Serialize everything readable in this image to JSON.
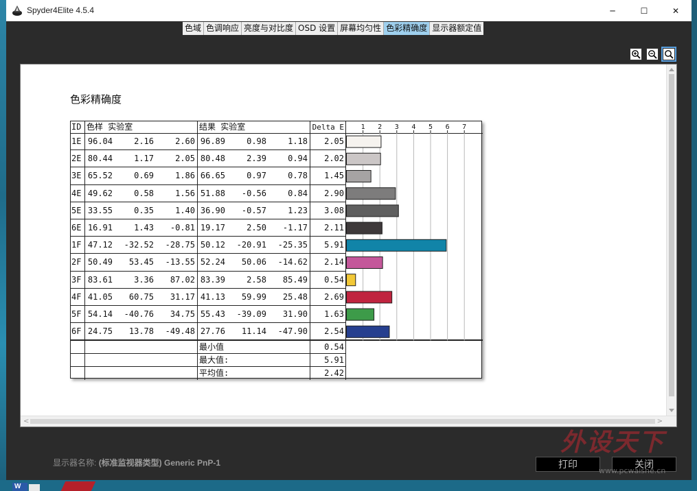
{
  "window": {
    "title": "Spyder4Elite 4.5.4",
    "controls": {
      "minimize": "─",
      "maximize": "☐",
      "close": "✕"
    }
  },
  "tabs": [
    {
      "label": "色域",
      "active": false
    },
    {
      "label": "色调响应",
      "active": false
    },
    {
      "label": "亮度与对比度",
      "active": false
    },
    {
      "label": "OSD 设置",
      "active": false
    },
    {
      "label": "屏幕均匀性",
      "active": false
    },
    {
      "label": "色彩精确度",
      "active": true
    },
    {
      "label": "显示器额定值",
      "active": false
    }
  ],
  "zoom_tools": [
    "zoom-in-icon",
    "zoom-out-icon",
    "zoom-fit-icon"
  ],
  "report": {
    "title": "色彩精确度",
    "headers": {
      "id": "ID",
      "sample": "色样 实验室",
      "result": "结果 实验室",
      "delta": "Delta E"
    },
    "rows": [
      {
        "id": "1E",
        "sample": [
          "96.04",
          "2.16",
          "2.60"
        ],
        "result": [
          "96.89",
          "0.98",
          "1.18"
        ],
        "delta": "2.05"
      },
      {
        "id": "2E",
        "sample": [
          "80.44",
          "1.17",
          "2.05"
        ],
        "result": [
          "80.48",
          "2.39",
          "0.94"
        ],
        "delta": "2.02"
      },
      {
        "id": "3E",
        "sample": [
          "65.52",
          "0.69",
          "1.86"
        ],
        "result": [
          "66.65",
          "0.97",
          "0.78"
        ],
        "delta": "1.45"
      },
      {
        "id": "4E",
        "sample": [
          "49.62",
          "0.58",
          "1.56"
        ],
        "result": [
          "51.88",
          "-0.56",
          "0.84"
        ],
        "delta": "2.90"
      },
      {
        "id": "5E",
        "sample": [
          "33.55",
          "0.35",
          "1.40"
        ],
        "result": [
          "36.90",
          "-0.57",
          "1.23"
        ],
        "delta": "3.08"
      },
      {
        "id": "6E",
        "sample": [
          "16.91",
          "1.43",
          "-0.81"
        ],
        "result": [
          "19.17",
          "2.50",
          "-1.17"
        ],
        "delta": "2.11"
      },
      {
        "id": "1F",
        "sample": [
          "47.12",
          "-32.52",
          "-28.75"
        ],
        "result": [
          "50.12",
          "-20.91",
          "-25.35"
        ],
        "delta": "5.91"
      },
      {
        "id": "2F",
        "sample": [
          "50.49",
          "53.45",
          "-13.55"
        ],
        "result": [
          "52.24",
          "50.06",
          "-14.62"
        ],
        "delta": "2.14"
      },
      {
        "id": "3F",
        "sample": [
          "83.61",
          "3.36",
          "87.02"
        ],
        "result": [
          "83.39",
          "2.58",
          "85.49"
        ],
        "delta": "0.54"
      },
      {
        "id": "4F",
        "sample": [
          "41.05",
          "60.75",
          "31.17"
        ],
        "result": [
          "41.13",
          "59.99",
          "25.48"
        ],
        "delta": "2.69"
      },
      {
        "id": "5F",
        "sample": [
          "54.14",
          "-40.76",
          "34.75"
        ],
        "result": [
          "55.43",
          "-39.09",
          "31.90"
        ],
        "delta": "1.63"
      },
      {
        "id": "6F",
        "sample": [
          "24.75",
          "13.78",
          "-49.48"
        ],
        "result": [
          "27.76",
          "11.14",
          "-47.90"
        ],
        "delta": "2.54"
      }
    ],
    "summary": [
      {
        "label": "最小值",
        "value": "0.54"
      },
      {
        "label": "最大值:",
        "value": "5.91"
      },
      {
        "label": "平均值:",
        "value": "2.42"
      }
    ]
  },
  "chart_data": {
    "type": "bar",
    "orientation": "horizontal",
    "categories": [
      "1E",
      "2E",
      "3E",
      "4E",
      "5E",
      "6E",
      "1F",
      "2F",
      "3F",
      "4F",
      "5F",
      "6F"
    ],
    "values": [
      2.05,
      2.02,
      1.45,
      2.9,
      3.08,
      2.11,
      5.91,
      2.14,
      0.54,
      2.69,
      1.63,
      2.54
    ],
    "colors": [
      "#f6f3ef",
      "#cbc6c6",
      "#a6a3a3",
      "#7d7c7c",
      "#5f5f5f",
      "#3e393a",
      "#1184a8",
      "#c4579a",
      "#f2c837",
      "#c0243f",
      "#3d9b49",
      "#263f8f"
    ],
    "xticks": [
      "1",
      "2",
      "3",
      "4",
      "5",
      "6",
      "7"
    ],
    "xlim": [
      0,
      8
    ],
    "grid": true
  },
  "footer": {
    "monitor_label": "显示器名称:",
    "monitor_value": "(标准监视器类型) Generic PnP-1",
    "print_button": "打印",
    "close_button": "关闭"
  },
  "watermark": {
    "main": "外设天下",
    "url": "www.pcwaishe.cn"
  }
}
